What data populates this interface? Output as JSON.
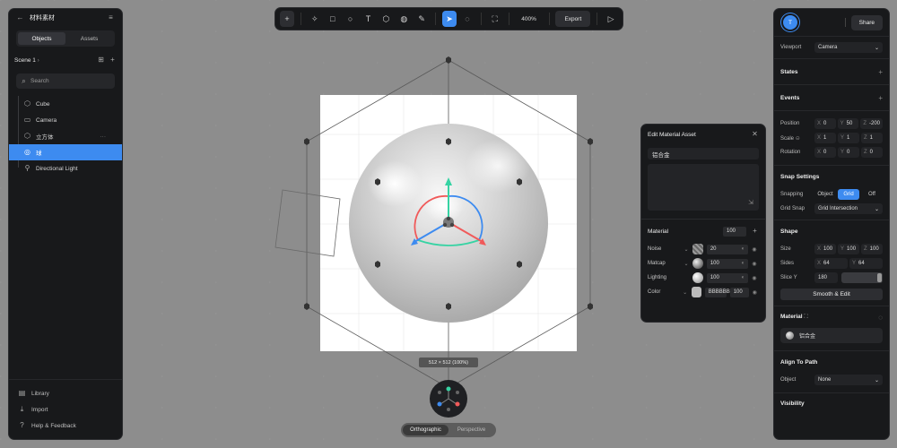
{
  "left_panel": {
    "title": "材料素材",
    "tabs": [
      "Objects",
      "Assets"
    ],
    "scene": "Scene 1",
    "search_placeholder": "Search",
    "tree": [
      {
        "label": "Cube",
        "icon": "cube-icon"
      },
      {
        "label": "Camera",
        "icon": "camera-icon"
      },
      {
        "label": "立方体",
        "icon": "cube-icon"
      },
      {
        "label": "球",
        "icon": "sphere-icon"
      },
      {
        "label": "Directional Light",
        "icon": "light-icon"
      }
    ],
    "selected_index": 3,
    "footer": [
      "Library",
      "Import",
      "Help & Feedback"
    ]
  },
  "toolbar": {
    "zoom": "400%",
    "export_label": "Export",
    "tools": [
      "add-icon",
      "magic-icon",
      "rectangle-icon",
      "ellipse-icon",
      "text-icon",
      "cube-icon",
      "sphere-icon",
      "pen-icon",
      "select-icon",
      "comment-icon",
      "frame-icon"
    ],
    "active_tool": "select-icon"
  },
  "viewport": {
    "artboard_size": "512 × 512 (100%)",
    "view_modes": [
      "Orthographic",
      "Perspective"
    ],
    "active_view": "Orthographic",
    "axis_colors": {
      "x": "#f05a5a",
      "y": "#36d3a3",
      "z": "#3d8bf0"
    }
  },
  "material_popup": {
    "title": "Edit Material Asset",
    "name": "铝合金",
    "material_label": "Material",
    "material_value": "100",
    "props": [
      {
        "label": "Noise",
        "value": "20",
        "swatch": "#8c8c8c"
      },
      {
        "label": "Matcap",
        "value": "100",
        "swatch": "#555555"
      },
      {
        "label": "Lighting",
        "value": "100",
        "swatch": "#bdbdbd"
      },
      {
        "label": "Color",
        "value": "BBBBBB",
        "extra": "100",
        "swatch": "#bbbbbb"
      }
    ]
  },
  "right_panel": {
    "avatar": "T",
    "share_label": "Share",
    "viewport_label": "Viewport",
    "viewport_value": "Camera",
    "states_label": "States",
    "events_label": "Events",
    "position": {
      "label": "Position",
      "x": "0",
      "y": "50",
      "z": "-200"
    },
    "scale": {
      "label": "Scale",
      "x": "1",
      "y": "1",
      "z": "1"
    },
    "rotation": {
      "label": "Rotation",
      "x": "0",
      "y": "0",
      "z": "0"
    },
    "snap_title": "Snap Settings",
    "snapping_label": "Snapping",
    "snapping_options": [
      "Object",
      "Grid",
      "Off"
    ],
    "snapping_active": "Grid",
    "grid_snap_label": "Grid Snap",
    "grid_snap_value": "Grid Intersection",
    "shape_title": "Shape",
    "size": {
      "label": "Size",
      "x": "100",
      "y": "100",
      "z": "100"
    },
    "sides": {
      "label": "Sides",
      "x": "64",
      "y": "64"
    },
    "slice_y": {
      "label": "Slice Y",
      "value": "180"
    },
    "smooth_btn": "Smooth & Edit",
    "material_title": "Material",
    "material_name": "铝合金",
    "align_title": "Align To Path",
    "object_label": "Object",
    "object_value": "None",
    "visibility_title": "Visibility"
  }
}
